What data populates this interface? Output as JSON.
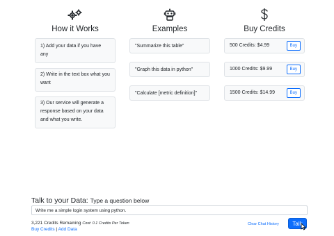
{
  "columns": {
    "how": {
      "icon": "gears-icon",
      "title": "How it Works",
      "steps": [
        "1) Add your data if you have any",
        "2) Write in the text box what you want",
        "3) Our service will generate a response based on your data and what you write."
      ]
    },
    "examples": {
      "icon": "robot-icon",
      "title": "Examples",
      "items": [
        "\"Summarize this table\"",
        "\"Graph this data in python\"",
        "\"Calculate [metric definition]\""
      ]
    },
    "credits": {
      "icon": "dollar-icon",
      "title": "Buy Credits",
      "packages": [
        {
          "label": "500 Credits: $4.99",
          "button": "Buy"
        },
        {
          "label": "1000 Credits: $9.99",
          "button": "Buy"
        },
        {
          "label": "1500 Credits: $14.99",
          "button": "Buy"
        }
      ]
    }
  },
  "talk": {
    "label": "Talk to your Data:",
    "hint": "Type a question below",
    "input_value": "Write me a simple login system using python.",
    "credits_remaining": "3,221 Credits Remaining",
    "cost": "Cost: 0.1 Credits Per Token",
    "buy_link": "Buy Credits",
    "separator": "|",
    "add_link": "Add Data",
    "clear_link": "Clear Chat History",
    "talk_button": "Talk"
  },
  "colors": {
    "accent": "#0d6efd",
    "card_bg": "#f8f9fa",
    "border": "#dee2e6"
  }
}
